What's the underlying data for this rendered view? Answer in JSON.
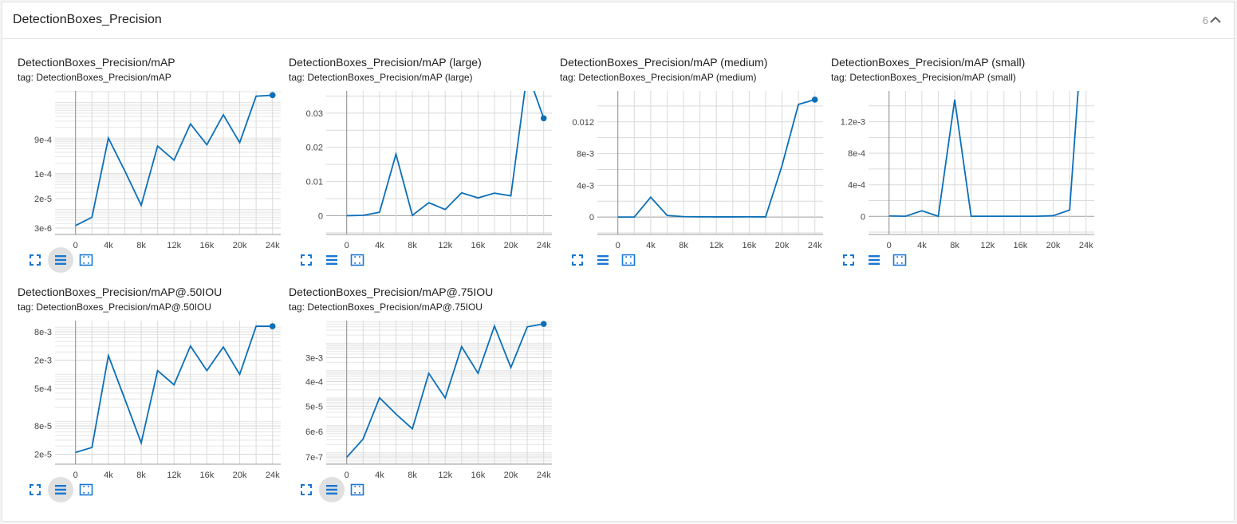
{
  "pane": {
    "title": "DetectionBoxes_Precision",
    "count": "6"
  },
  "icons": {
    "fullscreen": "fullscreen-icon",
    "toggle_y_axis_log": "list-lines-icon",
    "fit_domain": "fit-domain-icon",
    "collapse": "chevron-up-icon"
  },
  "colors": {
    "line": "#0b6fb8",
    "icon": "#1976d2",
    "grid": "#dadada",
    "axis": "#888888"
  },
  "cards": [
    {
      "title": "DetectionBoxes_Precision/mAP",
      "tag": "tag: DetectionBoxes_Precision/mAP",
      "chart_data": {
        "type": "line",
        "scale": "log",
        "x_ticks": [
          "0",
          "4k",
          "8k",
          "12k",
          "16k",
          "20k",
          "24k"
        ],
        "y_ticks": [
          "3e-6",
          "2e-5",
          "1e-4",
          "9e-4"
        ],
        "x": [
          0,
          2000,
          4000,
          6000,
          8000,
          10000,
          12000,
          14000,
          16000,
          18000,
          20000,
          22000,
          24000
        ],
        "y": [
          3.5e-06,
          6e-06,
          0.001,
          0.00012,
          1.3e-05,
          0.0006,
          0.00024,
          0.0025,
          0.00065,
          0.0045,
          0.00075,
          0.015,
          0.016
        ],
        "xlim": [
          -2500,
          25000
        ]
      }
    },
    {
      "title": "DetectionBoxes_Precision/mAP (large)",
      "tag": "tag: DetectionBoxes_Precision/mAP (large)",
      "chart_data": {
        "type": "line",
        "scale": "linear",
        "x_ticks": [
          "0",
          "4k",
          "8k",
          "12k",
          "16k",
          "20k",
          "24k"
        ],
        "y_ticks": [
          "0",
          "0.01",
          "0.02",
          "0.03"
        ],
        "y_tick_values": [
          0,
          0.01,
          0.02,
          0.03
        ],
        "ylim": [
          -0.0055,
          0.0365
        ],
        "x": [
          0,
          2000,
          4000,
          6000,
          8000,
          10000,
          12000,
          14000,
          16000,
          18000,
          20000,
          22000,
          24000
        ],
        "y": [
          0,
          0.0001,
          0.001,
          0.018,
          0.0001,
          0.0038,
          0.0018,
          0.0067,
          0.0052,
          0.0066,
          0.0058,
          0.042,
          0.0285
        ],
        "xlim": [
          -2500,
          25000
        ]
      }
    },
    {
      "title": "DetectionBoxes_Precision/mAP (medium)",
      "tag": "tag: DetectionBoxes_Precision/mAP (medium)",
      "chart_data": {
        "type": "line",
        "scale": "linear",
        "x_ticks": [
          "0",
          "4k",
          "8k",
          "12k",
          "16k",
          "20k",
          "24k"
        ],
        "y_ticks": [
          "0",
          "4e-3",
          "8e-3",
          "0.012"
        ],
        "y_tick_values": [
          0,
          0.004,
          0.008,
          0.012
        ],
        "ylim": [
          -0.0022,
          0.0159
        ],
        "x": [
          0,
          2000,
          4000,
          6000,
          8000,
          10000,
          12000,
          14000,
          16000,
          18000,
          20000,
          22000,
          24000
        ],
        "y": [
          0,
          0,
          0.0025,
          0.0002,
          5e-05,
          3e-05,
          2e-05,
          2e-05,
          3e-05,
          2e-05,
          0.0065,
          0.0142,
          0.0148
        ],
        "xlim": [
          -2500,
          25000
        ]
      }
    },
    {
      "title": "DetectionBoxes_Precision/mAP (small)",
      "tag": "tag: DetectionBoxes_Precision/mAP (small)",
      "chart_data": {
        "type": "line",
        "scale": "linear",
        "x_ticks": [
          "0",
          "4k",
          "8k",
          "12k",
          "16k",
          "20k",
          "24k"
        ],
        "y_ticks": [
          "0",
          "4e-4",
          "8e-4",
          "1.2e-3"
        ],
        "y_tick_values": [
          0,
          0.0004,
          0.0008,
          0.0012
        ],
        "ylim": [
          -0.00023,
          0.00159
        ],
        "x": [
          0,
          2000,
          4000,
          6000,
          8000,
          10000,
          12000,
          14000,
          16000,
          18000,
          20000,
          22000,
          24000
        ],
        "y": [
          5e-06,
          1e-06,
          7e-05,
          1e-06,
          0.00148,
          1e-06,
          1e-06,
          1e-06,
          1e-06,
          1e-06,
          8e-06,
          8e-05,
          0.003
        ],
        "xlim": [
          -2500,
          25000
        ]
      }
    },
    {
      "title": "DetectionBoxes_Precision/mAP@.50IOU",
      "tag": "tag: DetectionBoxes_Precision/mAP@.50IOU",
      "chart_data": {
        "type": "line",
        "scale": "log",
        "x_ticks": [
          "0",
          "4k",
          "8k",
          "12k",
          "16k",
          "20k",
          "24k"
        ],
        "y_ticks": [
          "2e-5",
          "8e-5",
          "5e-4",
          "2e-3",
          "8e-3"
        ],
        "x": [
          0,
          2000,
          4000,
          6000,
          8000,
          10000,
          12000,
          14000,
          16000,
          18000,
          20000,
          22000,
          24000
        ],
        "y": [
          2.2e-05,
          2.8e-05,
          0.0025,
          0.0003,
          3.5e-05,
          0.0012,
          0.0006,
          0.004,
          0.0012,
          0.0038,
          0.001,
          0.0105,
          0.0105
        ],
        "xlim": [
          -2500,
          25000
        ]
      }
    },
    {
      "title": "DetectionBoxes_Precision/mAP@.75IOU",
      "tag": "tag: DetectionBoxes_Precision/mAP@.75IOU",
      "chart_data": {
        "type": "line",
        "scale": "log",
        "x_ticks": [
          "0",
          "4k",
          "8k",
          "12k",
          "16k",
          "20k",
          "24k"
        ],
        "y_ticks": [
          "7e-7",
          "6e-6",
          "5e-5",
          "4e-4",
          "3e-3"
        ],
        "x": [
          0,
          2000,
          4000,
          6000,
          8000,
          10000,
          12000,
          14000,
          16000,
          18000,
          20000,
          22000,
          24000
        ],
        "y": [
          6.8e-07,
          3.2e-06,
          0.000102,
          2.6e-05,
          7.5e-06,
          0.0008,
          0.0001,
          0.0075,
          0.0008,
          0.043,
          0.0013,
          0.04,
          0.051
        ],
        "xlim": [
          -2500,
          25000
        ]
      }
    }
  ]
}
